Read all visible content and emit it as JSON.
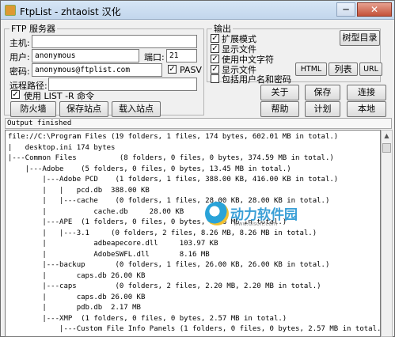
{
  "window": {
    "title": "FtpList - zhtaoist 汉化",
    "min": "─",
    "close": "✕"
  },
  "ftp": {
    "legend": "FTP 服务器",
    "host_label": "主机:",
    "host_value": "",
    "user_label": "用户:",
    "user_value": "anonymous",
    "port_label": "端口:",
    "port_value": "21",
    "pass_label": "密码:",
    "pass_value": "anonymous@ftplist.com",
    "pasv_label": "PASV",
    "pasv_checked": true,
    "remote_label": "远程路径:",
    "remote_value": "",
    "list_r_label": "使用 LIST -R 命令",
    "list_r_checked": true,
    "firewall_button": "防火墙",
    "save_site_button": "保存站点",
    "load_site_button": "载入站点"
  },
  "output_group": {
    "legend": "输出",
    "options": [
      {
        "label": "扩展模式",
        "checked": true
      },
      {
        "label": "显示文件",
        "checked": true
      },
      {
        "label": "使用中文字符",
        "checked": true
      }
    ],
    "tree_dir_button": "树型目录",
    "file_options": [
      {
        "label": "显示文件",
        "checked": true
      },
      {
        "label": "包括用户名和密码",
        "checked": false
      }
    ],
    "html_button": "HTML",
    "list_button": "列表",
    "url_button": "URL"
  },
  "actions": {
    "about": "关于",
    "save": "保存",
    "connect": "连接",
    "help": "帮助",
    "plan": "计划",
    "local": "本地"
  },
  "status_text": "Output finished",
  "output_lines": [
    "file://C:\\Program Files (19 folders, 1 files, 174 bytes, 602.01 MB in total.)",
    "|   desktop.ini 174 bytes",
    "|---Common Files          (8 folders, 0 files, 0 bytes, 374.59 MB in total.)",
    "    |---Adobe    (5 folders, 0 files, 0 bytes, 13.45 MB in total.)",
    "        |---Adobe PCD    (1 folders, 1 files, 388.00 KB, 416.00 KB in total.)",
    "        |   |   pcd.db  388.00 KB",
    "        |   |---cache    (0 folders, 1 files, 28.00 KB, 28.00 KB in total.)",
    "        |           cache.db     28.00 KB",
    "        |---APE  (1 folders, 0 files, 0 bytes, 8.26 MB in total.)",
    "        |   |---3.1     (0 folders, 2 files, 8.26 MB, 8.26 MB in total.)",
    "        |           adbeapecore.dll     103.97 KB",
    "        |           AdobeSWFL.dll       8.16 MB",
    "        |---backup       (0 folders, 1 files, 26.00 KB, 26.00 KB in total.)",
    "        |       caps.db 26.00 KB",
    "        |---caps         (0 folders, 2 files, 2.20 MB, 2.20 MB in total.)",
    "        |       caps.db 26.00 KB",
    "        |       pdb.db  2.17 MB",
    "        |---XMP  (1 folders, 0 files, 0 bytes, 2.57 MB in total.)",
    "            |---Custom File Info Panels (1 folders, 0 files, 0 bytes, 2.57 MB in total.)"
  ],
  "watermark": {
    "text": "动力软件园",
    "sub": "www.dlsoft.com"
  }
}
